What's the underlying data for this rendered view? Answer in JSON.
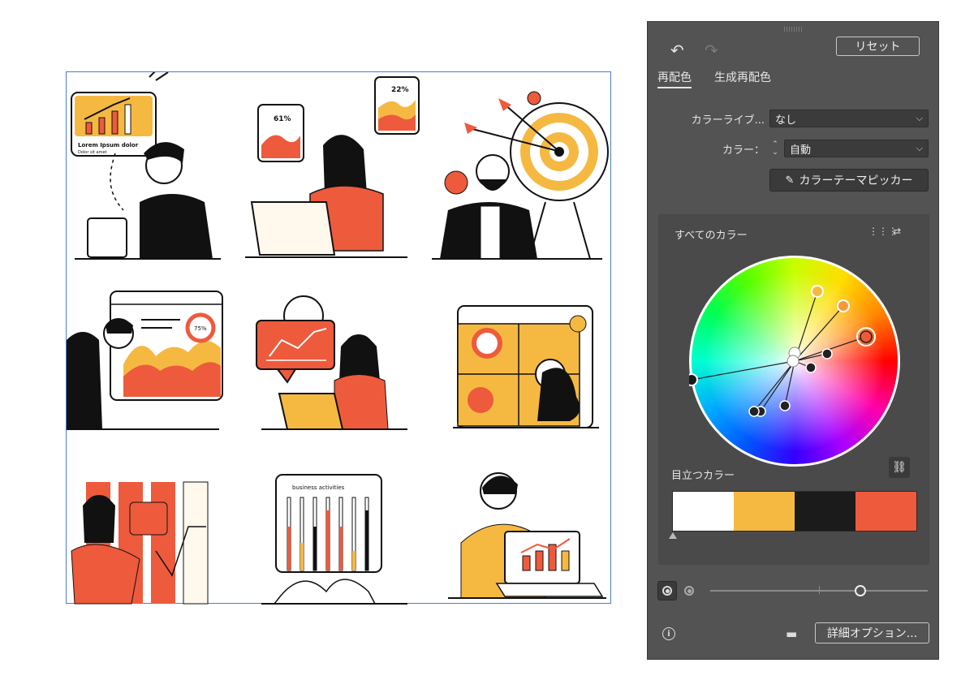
{
  "panel": {
    "reset_label": "リセット",
    "tabs": [
      "再配色",
      "生成再配色"
    ],
    "library_label": "カラーライブ...",
    "library_value": "なし",
    "color_label": "カラー：",
    "color_value": "自動",
    "picker_label": "カラーテーマピッカー",
    "all_colors_label": "すべてのカラー",
    "prominent_label": "目立つカラー",
    "advanced_label": "詳細オプション...",
    "swatches": [
      "#ffffff",
      "#f5b942",
      "#1b1b1b",
      "#ee5a3c"
    ],
    "icons": [
      "undo-icon",
      "redo-icon",
      "eyedropper-icon",
      "link-icon",
      "info-icon",
      "folder-icon"
    ]
  },
  "artboard": {
    "texts": {
      "chart1_pct": "61%",
      "chart2_pct": "22%",
      "lorem": "Lorem Ipsum dolor",
      "dolor": "Dolor sit amet",
      "pct75": "75%",
      "business": "business activities"
    }
  },
  "colors": {
    "orange": "#ee5a3c",
    "yellow": "#f5b942",
    "black": "#1b1b1b",
    "panel_bg": "#535353"
  }
}
